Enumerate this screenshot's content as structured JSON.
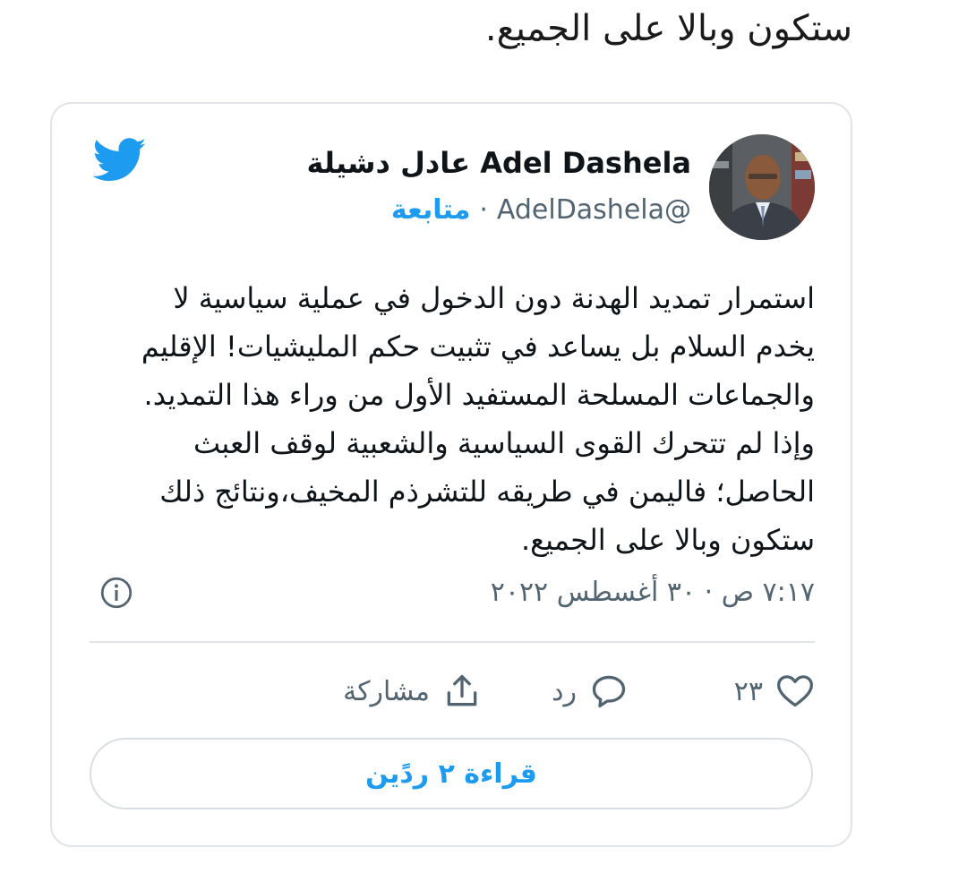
{
  "previous_text": "ستكون وبالا على الجميع.",
  "tweet": {
    "author": {
      "display_name": "Adel Dashela عادل دشيلة",
      "handle": "@AdelDashela",
      "follow_label": "متابعة",
      "separator": "·"
    },
    "body_lines": [
      "استمرار تمديد الهدنة دون الدخول في عملية سياسية لا",
      "يخدم السلام بل يساعد في تثبيت حكم المليشيات! الإقليم",
      "والجماعات المسلحة المستفيد الأول من وراء هذا التمديد.",
      "وإذا لم تتحرك القوى السياسية والشعبية لوقف العبث",
      "الحاصل؛ فاليمن في طريقه للتشرذم المخيف،ونتائج ذلك",
      "ستكون وبالا على الجميع."
    ],
    "timestamp": "٧:١٧ ص · ٣٠ أغسطس ٢٠٢٢",
    "actions": {
      "like_count": "٢٣",
      "reply_label": "رد",
      "share_label": "مشاركة"
    },
    "read_replies_label": "قراءة ٢ ردًين"
  },
  "colors": {
    "twitter_blue": "#1d9bf0",
    "muted_text": "#536471",
    "border": "#e1e5e9"
  },
  "icons": {
    "logo": "twitter-bird-icon",
    "info": "info-icon",
    "like": "heart-icon",
    "reply": "speech-bubble-icon",
    "share": "share-upload-icon"
  }
}
